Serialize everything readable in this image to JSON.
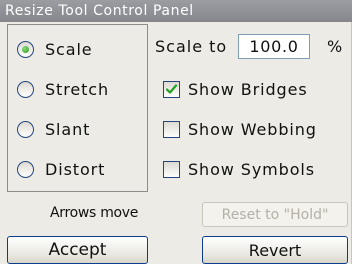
{
  "window": {
    "title": "Resize Tool Control Panel"
  },
  "mode_options": [
    {
      "label": "Scale",
      "selected": true
    },
    {
      "label": "Stretch",
      "selected": false
    },
    {
      "label": "Slant",
      "selected": false
    },
    {
      "label": "Distort",
      "selected": false
    }
  ],
  "scale": {
    "label": "Scale to",
    "value": "100.0",
    "unit": "%"
  },
  "options": [
    {
      "label": "Show Bridges",
      "checked": true
    },
    {
      "label": "Show Webbing",
      "checked": false
    },
    {
      "label": "Show Symbols",
      "checked": false
    }
  ],
  "hint": {
    "text": "Arrows move"
  },
  "buttons": {
    "reset_label": "Reset to \"Hold\"",
    "reset_enabled": false,
    "accept_label": "Accept",
    "revert_label": "Revert"
  },
  "colors": {
    "title_bar": "#8e9095",
    "panel_bg": "#ecebe5",
    "radio_selected": "#27991c",
    "check_mark": "#21a121",
    "button_border": "#0e3c8c"
  }
}
